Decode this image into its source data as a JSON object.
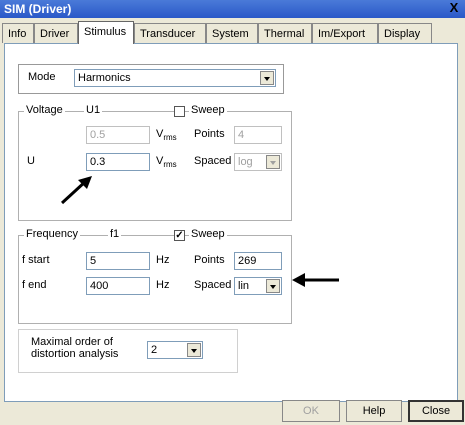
{
  "window": {
    "title": "SIM (Driver)",
    "close_glyph": "X"
  },
  "tabs": [
    {
      "label": "Info"
    },
    {
      "label": "Driver"
    },
    {
      "label": "Stimulus"
    },
    {
      "label": "Transducer"
    },
    {
      "label": "System"
    },
    {
      "label": "Thermal"
    },
    {
      "label": "Im/Export"
    },
    {
      "label": "Display"
    }
  ],
  "mode": {
    "label": "Mode",
    "value": "Harmonics"
  },
  "voltage": {
    "legend": "Voltage",
    "name": "U1",
    "sweep_label": "Sweep",
    "sweep_checked": false,
    "row1_value": "0.5",
    "unit_main": "V",
    "unit_sub": "rms",
    "points_label": "Points",
    "points_value": "4",
    "u_label": "U",
    "u_value": "0.3",
    "spaced_label": "Spaced",
    "spaced_value": "log"
  },
  "frequency": {
    "legend": "Frequency",
    "name": "f1",
    "sweep_label": "Sweep",
    "sweep_checked": true,
    "fstart_label": "f start",
    "fstart_value": "5",
    "fend_label": "f end",
    "fend_value": "400",
    "unit": "Hz",
    "points_label": "Points",
    "points_value": "269",
    "spaced_label": "Spaced",
    "spaced_value": "lin"
  },
  "distortion": {
    "label_line1": "Maximal order of",
    "label_line2": "distortion analysis",
    "value": "2"
  },
  "buttons": {
    "ok": "OK",
    "help": "Help",
    "close": "Close"
  },
  "check_glyph": "✓"
}
